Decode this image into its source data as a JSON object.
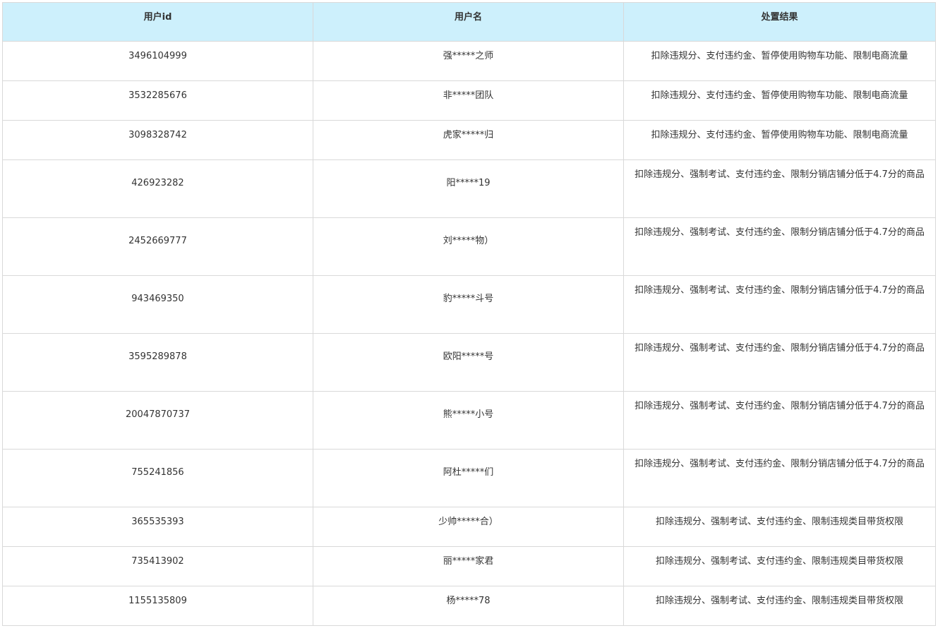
{
  "table": {
    "headers": [
      "用户id",
      "用户名",
      "处置结果"
    ],
    "rows": [
      {
        "id": "3496104999",
        "name": "强*****之师",
        "result": "扣除违规分、支付违约金、暂停使用购物车功能、限制电商流量",
        "tall": false
      },
      {
        "id": "3532285676",
        "name": "非*****团队",
        "result": "扣除违规分、支付违约金、暂停使用购物车功能、限制电商流量",
        "tall": false
      },
      {
        "id": "3098328742",
        "name": "虎家*****归",
        "result": "扣除违规分、支付违约金、暂停使用购物车功能、限制电商流量",
        "tall": false
      },
      {
        "id": "426923282",
        "name": "阳*****19",
        "result": "扣除违规分、强制考试、支付违约金、限制分销店铺分低于4.7分的商品",
        "tall": true
      },
      {
        "id": "2452669777",
        "name": "刘*****物）",
        "result": "扣除违规分、强制考试、支付违约金、限制分销店铺分低于4.7分的商品",
        "tall": true
      },
      {
        "id": "943469350",
        "name": "豹*****斗号",
        "result": "扣除违规分、强制考试、支付违约金、限制分销店铺分低于4.7分的商品",
        "tall": true
      },
      {
        "id": "3595289878",
        "name": "欧阳*****号",
        "result": "扣除违规分、强制考试、支付违约金、限制分销店铺分低于4.7分的商品",
        "tall": true
      },
      {
        "id": "20047870737",
        "name": "熊*****小号",
        "result": "扣除违规分、强制考试、支付违约金、限制分销店铺分低于4.7分的商品",
        "tall": true
      },
      {
        "id": "755241856",
        "name": "阿杜*****们",
        "result": "扣除违规分、强制考试、支付违约金、限制分销店铺分低于4.7分的商品",
        "tall": true
      },
      {
        "id": "365535393",
        "name": "少帅*****合）",
        "result": "扣除违规分、强制考试、支付违约金、限制违规类目带货权限",
        "tall": false
      },
      {
        "id": "735413902",
        "name": "丽*****家君",
        "result": "扣除违规分、强制考试、支付违约金、限制违规类目带货权限",
        "tall": false
      },
      {
        "id": "1155135809",
        "name": "杨*****78",
        "result": "扣除违规分、强制考试、支付违约金、限制违规类目带货权限",
        "tall": false
      }
    ]
  },
  "colors": {
    "header_bg": "#cdf0fc",
    "border": "#d9d9d9",
    "text": "#333333"
  }
}
